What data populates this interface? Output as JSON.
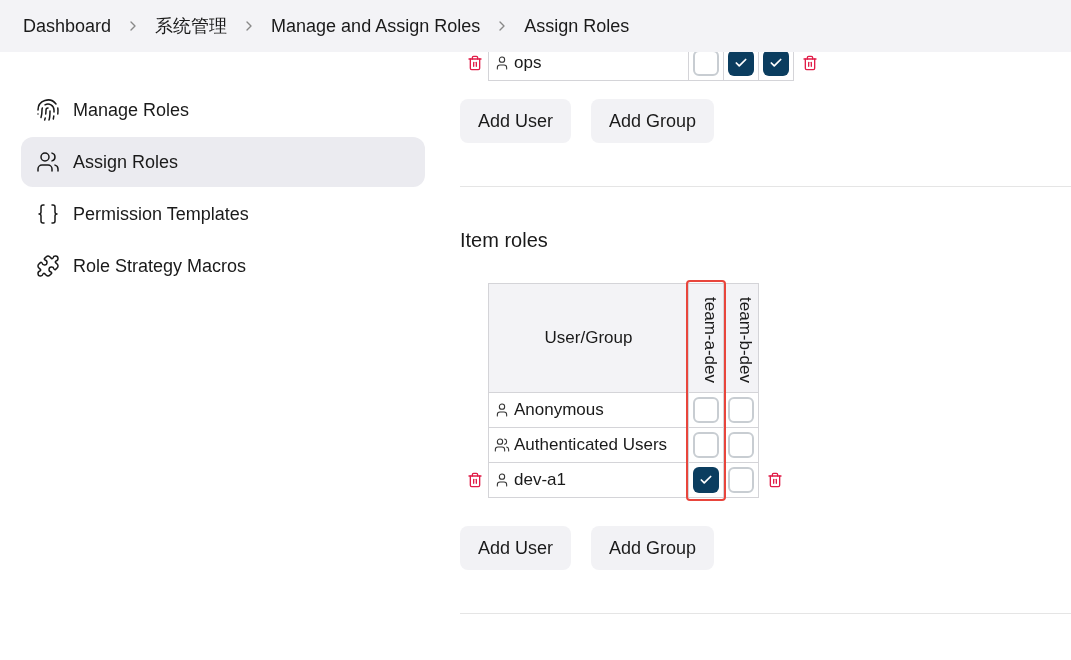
{
  "breadcrumbs": [
    "Dashboard",
    "系统管理",
    "Manage and Assign Roles",
    "Assign Roles"
  ],
  "sidebar": {
    "items": [
      {
        "label": "Manage Roles",
        "kind": "fingerprint",
        "selected": false
      },
      {
        "label": "Assign Roles",
        "kind": "users",
        "selected": true
      },
      {
        "label": "Permission Templates",
        "kind": "braces",
        "selected": false
      },
      {
        "label": "Role Strategy Macros",
        "kind": "puzzle",
        "selected": false
      }
    ]
  },
  "global_roles": {
    "rows": [
      {
        "name": "ops",
        "kind": "user",
        "roles": [
          false,
          true,
          true
        ],
        "deletable": true
      }
    ],
    "buttons": [
      "Add User",
      "Add Group"
    ]
  },
  "item_roles": {
    "title": "Item roles",
    "header": "User/Group",
    "roles": [
      {
        "name": "team-a-dev",
        "highlighted": true
      },
      {
        "name": "team-b-dev",
        "highlighted": false
      }
    ],
    "rows": [
      {
        "name": "Anonymous",
        "kind": "user",
        "roles": [
          false,
          false
        ],
        "deletable": false
      },
      {
        "name": "Authenticated Users",
        "kind": "group",
        "roles": [
          false,
          false
        ],
        "deletable": false
      },
      {
        "name": "dev-a1",
        "kind": "user",
        "roles": [
          true,
          false
        ],
        "deletable": true
      }
    ],
    "buttons": [
      "Add User",
      "Add Group"
    ]
  }
}
